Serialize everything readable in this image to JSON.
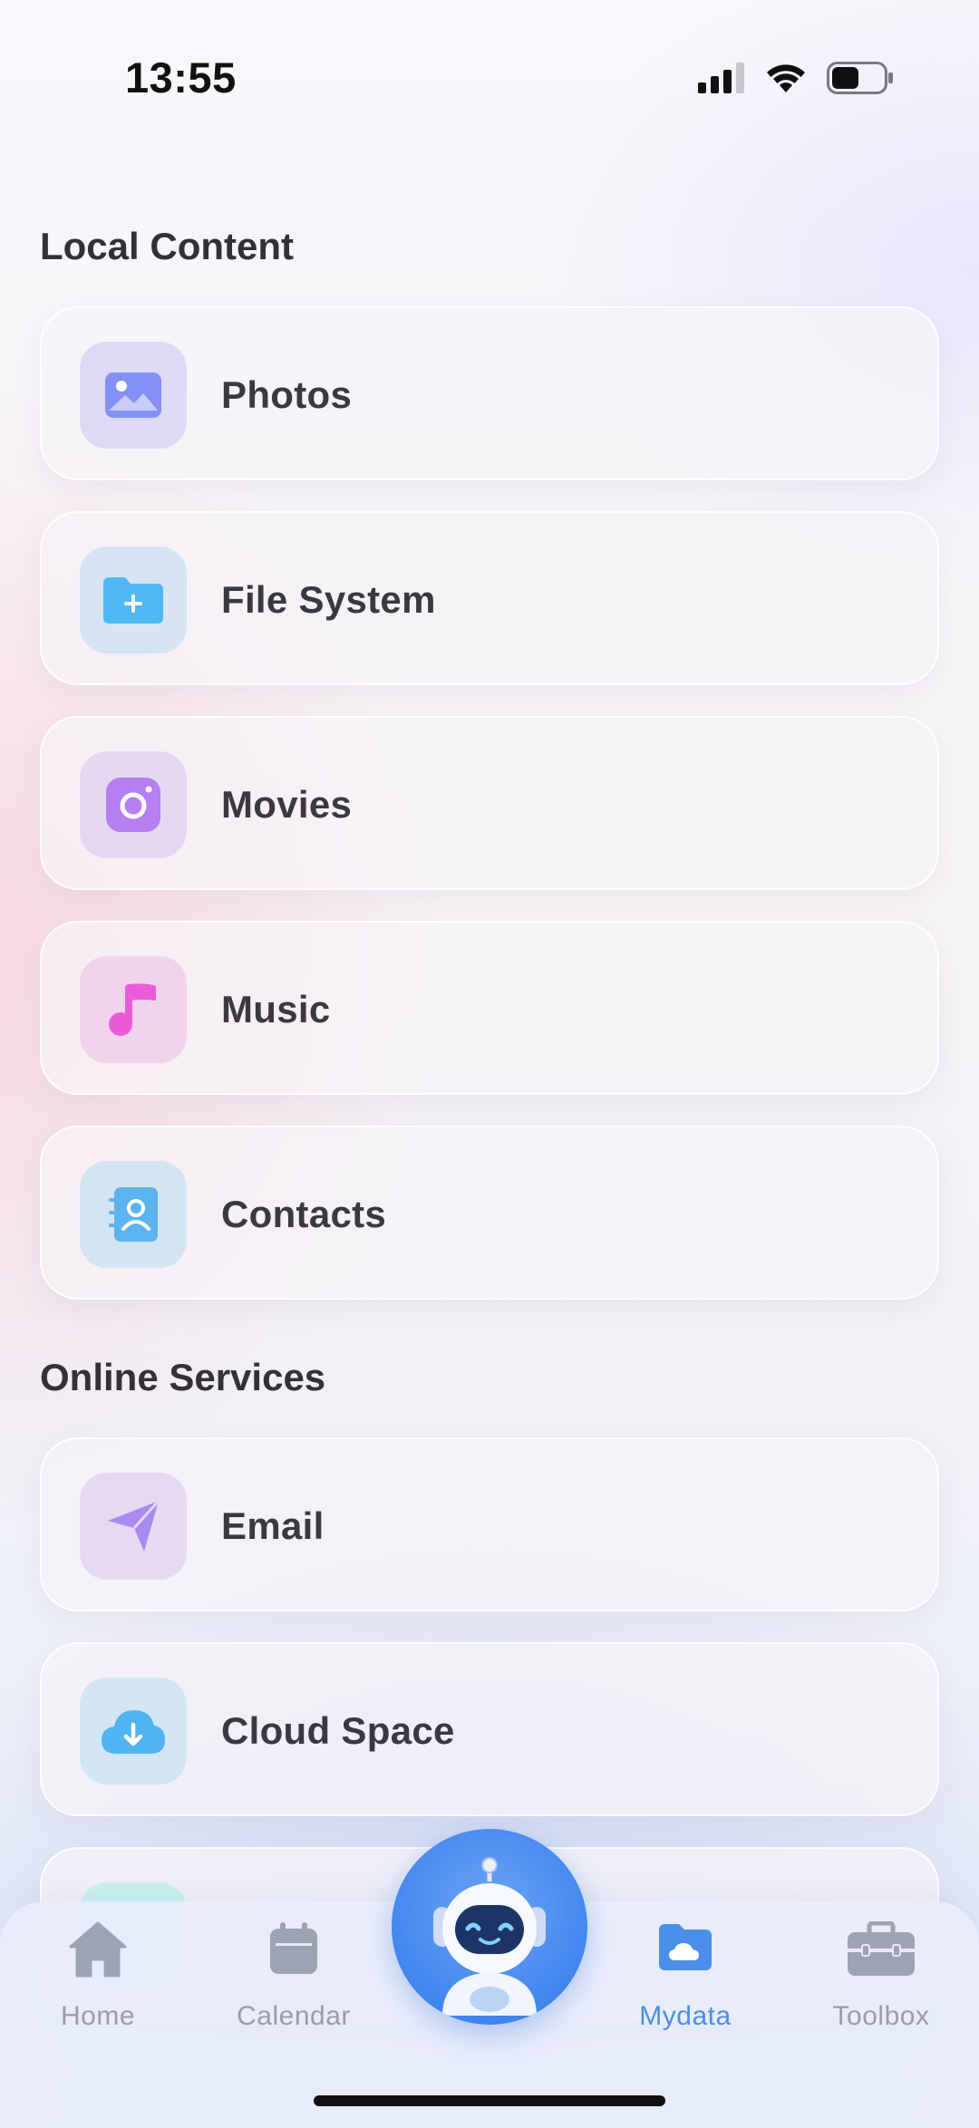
{
  "status_bar": {
    "time": "13:55",
    "signal_icon": "cellular-signal-icon",
    "wifi_icon": "wifi-icon",
    "battery_icon": "battery-icon",
    "battery_level_fraction": 0.5
  },
  "sections": {
    "local": {
      "title": "Local Content",
      "items": [
        {
          "label": "Photos",
          "icon": "photo-icon",
          "color": "#7f8ef2"
        },
        {
          "label": "File System",
          "icon": "folder-icon",
          "color": "#4fb5f2"
        },
        {
          "label": "Movies",
          "icon": "camera-icon",
          "color": "#b07cf0"
        },
        {
          "label": "Music",
          "icon": "music-note-icon",
          "color": "#ea5fd6"
        },
        {
          "label": "Contacts",
          "icon": "contacts-book-icon",
          "color": "#5fb2ee"
        }
      ]
    },
    "online": {
      "title": "Online Services",
      "items": [
        {
          "label": "Email",
          "icon": "send-plane-icon",
          "color": "#a988f2"
        },
        {
          "label": "Cloud Space",
          "icon": "cloud-download-icon",
          "color": "#4fb3f0"
        }
      ]
    }
  },
  "tabbar": {
    "tabs": [
      {
        "label": "Home",
        "icon": "home-icon",
        "active": false
      },
      {
        "label": "Calendar",
        "icon": "calendar-icon",
        "active": false
      },
      {
        "label": "Mydata",
        "icon": "cloud-folder-icon",
        "active": true
      },
      {
        "label": "Toolbox",
        "icon": "toolbox-icon",
        "active": false
      }
    ],
    "center_button_icon": "robot-assistant-icon",
    "active_color": "#4a8fea",
    "inactive_color": "#9a9ca6"
  }
}
